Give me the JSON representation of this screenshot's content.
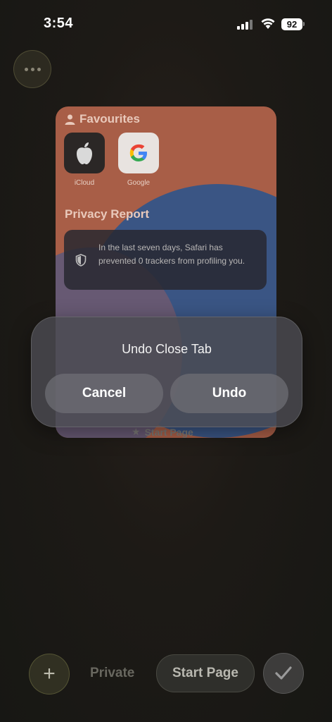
{
  "status_bar": {
    "time": "3:54",
    "battery": "92"
  },
  "tab_card": {
    "favourites_title": "Favourites",
    "favourites": [
      {
        "label": "iCloud",
        "icon": "apple-icon"
      },
      {
        "label": "Google",
        "icon": "google-icon"
      }
    ],
    "privacy_title": "Privacy Report",
    "privacy_text": "In the last seven days, Safari has prevented 0 trackers from profiling you.",
    "caption": "Start Page"
  },
  "dialog": {
    "title": "Undo Close Tab",
    "cancel_label": "Cancel",
    "undo_label": "Undo"
  },
  "toolbar": {
    "add_label": "+",
    "private_label": "Private",
    "start_page_label": "Start Page"
  },
  "colors": {
    "card_orange": "#b1644b",
    "card_blue": "#3e5a8c",
    "dialog_bg": "#4a4a50"
  }
}
